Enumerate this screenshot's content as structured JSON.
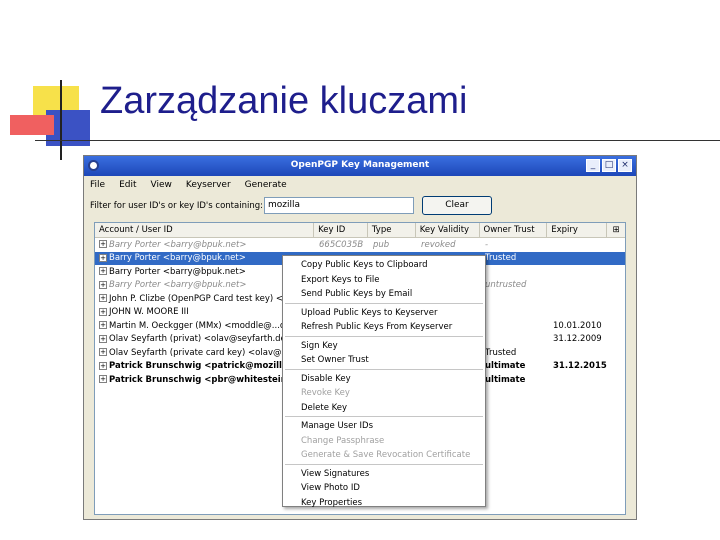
{
  "slide": {
    "title": "Zarządzanie kluczami"
  },
  "window": {
    "title": "OpenPGP Key Management",
    "controls": [
      "_",
      "□",
      "×"
    ]
  },
  "menubar": [
    "File",
    "Edit",
    "View",
    "Keyserver",
    "Generate"
  ],
  "filter": {
    "label": "Filter for user ID's or key ID's containing:",
    "value": "mozilla",
    "clear_label": "Clear"
  },
  "columns": [
    "Account / User ID",
    "Key ID",
    "Type",
    "Key Validity",
    "Owner Trust",
    "Expiry"
  ],
  "rows": [
    {
      "account": "Barry Porter <barry@bpuk.net>",
      "keyid": "665C035B",
      "type": "pub",
      "validity": "revoked",
      "trust": "-",
      "expiry": "",
      "style": "gray"
    },
    {
      "account": "Barry Porter <barry@bpuk.net>",
      "keyid": "",
      "type": "",
      "validity": "",
      "trust": "Trusted",
      "expiry": "",
      "style": "selected"
    },
    {
      "account": "Barry Porter <barry@bpuk.net>",
      "keyid": "",
      "type": "",
      "validity": "",
      "trust": "",
      "expiry": "",
      "style": ""
    },
    {
      "account": "Barry Porter <barry@bpuk.net>",
      "keyid": "",
      "type": "",
      "validity": "",
      "trust": "untrusted",
      "expiry": "",
      "style": "gray"
    },
    {
      "account": "John P. Clizbe (OpenPGP Card test key) <j",
      "keyid": "",
      "type": "",
      "validity": "",
      "trust": "",
      "expiry": "",
      "style": ""
    },
    {
      "account": "JOHN W. MOORE III",
      "keyid": "",
      "type": "",
      "validity": "",
      "trust": "",
      "expiry": "",
      "style": ""
    },
    {
      "account": "Martin M. Oeckgger (MMx) <moddle@...com",
      "keyid": "",
      "type": "",
      "validity": "",
      "trust": "",
      "expiry": "10.01.2010",
      "style": ""
    },
    {
      "account": "Olav Seyfarth (privat) <olav@seyfarth.de>",
      "keyid": "",
      "type": "",
      "validity": "",
      "trust": "",
      "expiry": "31.12.2009",
      "style": ""
    },
    {
      "account": "Olav Seyfarth (private card key) <olav@sey",
      "keyid": "",
      "type": "",
      "validity": "",
      "trust": "Trusted",
      "expiry": "",
      "style": ""
    },
    {
      "account": "Patrick Brunschwig <patrick@mozilla",
      "keyid": "",
      "type": "",
      "validity": "",
      "trust": "ultimate",
      "expiry": "31.12.2015",
      "style": "bold"
    },
    {
      "account": "Patrick Brunschwig <pbr@whitestein.c",
      "keyid": "",
      "type": "",
      "validity": "",
      "trust": "ultimate",
      "expiry": "",
      "style": "bold"
    }
  ],
  "context_menu": {
    "groups": [
      [
        {
          "label": "Copy Public Keys to Clipboard",
          "enabled": true
        },
        {
          "label": "Export Keys to File",
          "enabled": true
        },
        {
          "label": "Send Public Keys by Email",
          "enabled": true
        }
      ],
      [
        {
          "label": "Upload Public Keys to Keyserver",
          "enabled": true
        },
        {
          "label": "Refresh Public Keys From Keyserver",
          "enabled": true
        }
      ],
      [
        {
          "label": "Sign Key",
          "enabled": true
        },
        {
          "label": "Set Owner Trust",
          "enabled": true
        }
      ],
      [
        {
          "label": "Disable Key",
          "enabled": true
        },
        {
          "label": "Revoke Key",
          "enabled": false
        },
        {
          "label": "Delete Key",
          "enabled": true
        }
      ],
      [
        {
          "label": "Manage User IDs",
          "enabled": true
        },
        {
          "label": "Change Passphrase",
          "enabled": false
        },
        {
          "label": "Generate & Save Revocation Certificate",
          "enabled": false
        }
      ],
      [
        {
          "label": "View Signatures",
          "enabled": true
        },
        {
          "label": "View Photo ID",
          "enabled": true
        },
        {
          "label": "Key Properties",
          "enabled": true
        }
      ]
    ]
  },
  "colors": {
    "slide_title": "#1e1e8c",
    "titlebar": "#1d47b8",
    "selection": "#316ac5",
    "window_bg": "#ece9d8"
  }
}
